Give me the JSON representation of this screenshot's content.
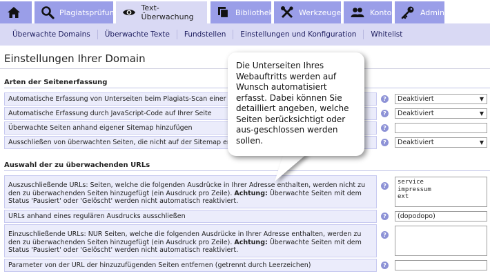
{
  "nav": {
    "tabs": [
      {
        "label": "Plagiatsprüfung",
        "icon": "magnifier-icon"
      },
      {
        "label": "Text-Überwachung",
        "icon": "eye-icon"
      },
      {
        "label": "Bibliothek",
        "icon": "library-icon"
      },
      {
        "label": "Werkzeuge",
        "icon": "tools-icon"
      },
      {
        "label": "Konto",
        "icon": "users-icon"
      },
      {
        "label": "Admin",
        "icon": "key-icon"
      }
    ],
    "home_icon": "home-icon"
  },
  "subnav": {
    "items": [
      "Überwachte Domains",
      "Überwachte Texte",
      "Fundstellen",
      "Einstellungen und Konfiguration",
      "Whitelist"
    ]
  },
  "page": {
    "title": "Einstellungen Ihrer Domain"
  },
  "section1": {
    "title": "Arten der Seitenerfassung",
    "rows": [
      {
        "label": "Automatische Erfassung von Unterseiten beim Plagiats-Scan einer Seite",
        "value": "Deaktiviert"
      },
      {
        "label": "Automatische Erfassung durch JavaScript-Code auf Ihrer Seite",
        "value": "Deaktiviert"
      },
      {
        "label": "Überwachte Seiten anhand eigener Sitemap hinzufügen",
        "value": ""
      },
      {
        "label": "Ausschließen von überwachten Seiten, die nicht auf der Sitemap erscheinen",
        "value": "Deaktiviert"
      }
    ]
  },
  "section2": {
    "title": "Auswahl der zu überwachenden URLs",
    "rows": [
      {
        "label_pre": "Auszuschließende URLs: Seiten, welche die folgenden Ausdrücke in Ihrer Adresse enthalten, werden nicht zu den zu überwachenden Seiten hinzugefügt (ein Ausdruck pro Zeile). ",
        "label_strong": "Achtung:",
        "label_post": " Überwachte Seiten mit dem Status 'Pausiert' oder 'Gelöscht' werden nicht automatisch reaktiviert.",
        "value": "service\nimpressum\next"
      },
      {
        "label": "URLs anhand eines regulären Ausdrucks ausschließen",
        "value": "(dopodopo)"
      },
      {
        "label_pre": "Einzuschließende URLs: NUR Seiten, welche die folgenden Ausdrücke in Ihrer Adresse enthalten, werden zu den zu überwachenden Seiten hinzugefügt (ein Ausdruck pro Zeile). ",
        "label_strong": "Achtung:",
        "label_post": " Überwachte Seiten mit dem Status 'Pausiert' oder 'Gelöscht' werden nicht automatisch reaktiviert.",
        "value": ""
      },
      {
        "label": "Parameter von der URL der hinzuzufügenden Seiten entfernen (getrennt durch Leerzeichen)",
        "value": ""
      }
    ]
  },
  "help_glyph": "?",
  "select_arrow": "▼",
  "bubble": {
    "text": "Die Unterseiten Ihres Webauftritts werden auf Wunsch automatisiert erfasst. Dabei können Sie detailliert angeben, welche Seiten berücksichtigt oder aus-geschlossen werden sollen."
  },
  "colors": {
    "tab": "#9a9ee8",
    "tab_active": "#d9d9f4",
    "label_bg": "#ebecfb"
  }
}
